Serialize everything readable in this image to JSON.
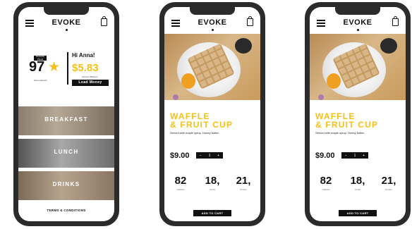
{
  "brand": "EVOKE",
  "home": {
    "score_badge": "Rewards Points",
    "score": "97",
    "score_label": "Score Earned",
    "greeting": "Hi Anna!",
    "balance": "$5.83",
    "balance_label": "Account Balance",
    "load_button": "Load Money",
    "categories": [
      "BREAKFAST",
      "LUNCH",
      "DRINKS"
    ],
    "terms": "TERMS & CONDITIONS"
  },
  "product": {
    "title_line1": "WAFFLE",
    "title_line2": "& FRUIT CUP",
    "description": "Served with maple syrup. Honey butter.",
    "price": "$9.00",
    "qty_minus": "−",
    "qty_value": "1",
    "qty_plus": "+",
    "stats": [
      {
        "value": "82",
        "label": "Calories"
      },
      {
        "value": "18,",
        "label": "Carbs"
      },
      {
        "value": "21,",
        "label": "Protein"
      }
    ],
    "add_to_cart": "ADD TO CART"
  },
  "colors": {
    "accent": "#f5c018",
    "dark": "#111111",
    "frame": "#2b2b2b"
  }
}
